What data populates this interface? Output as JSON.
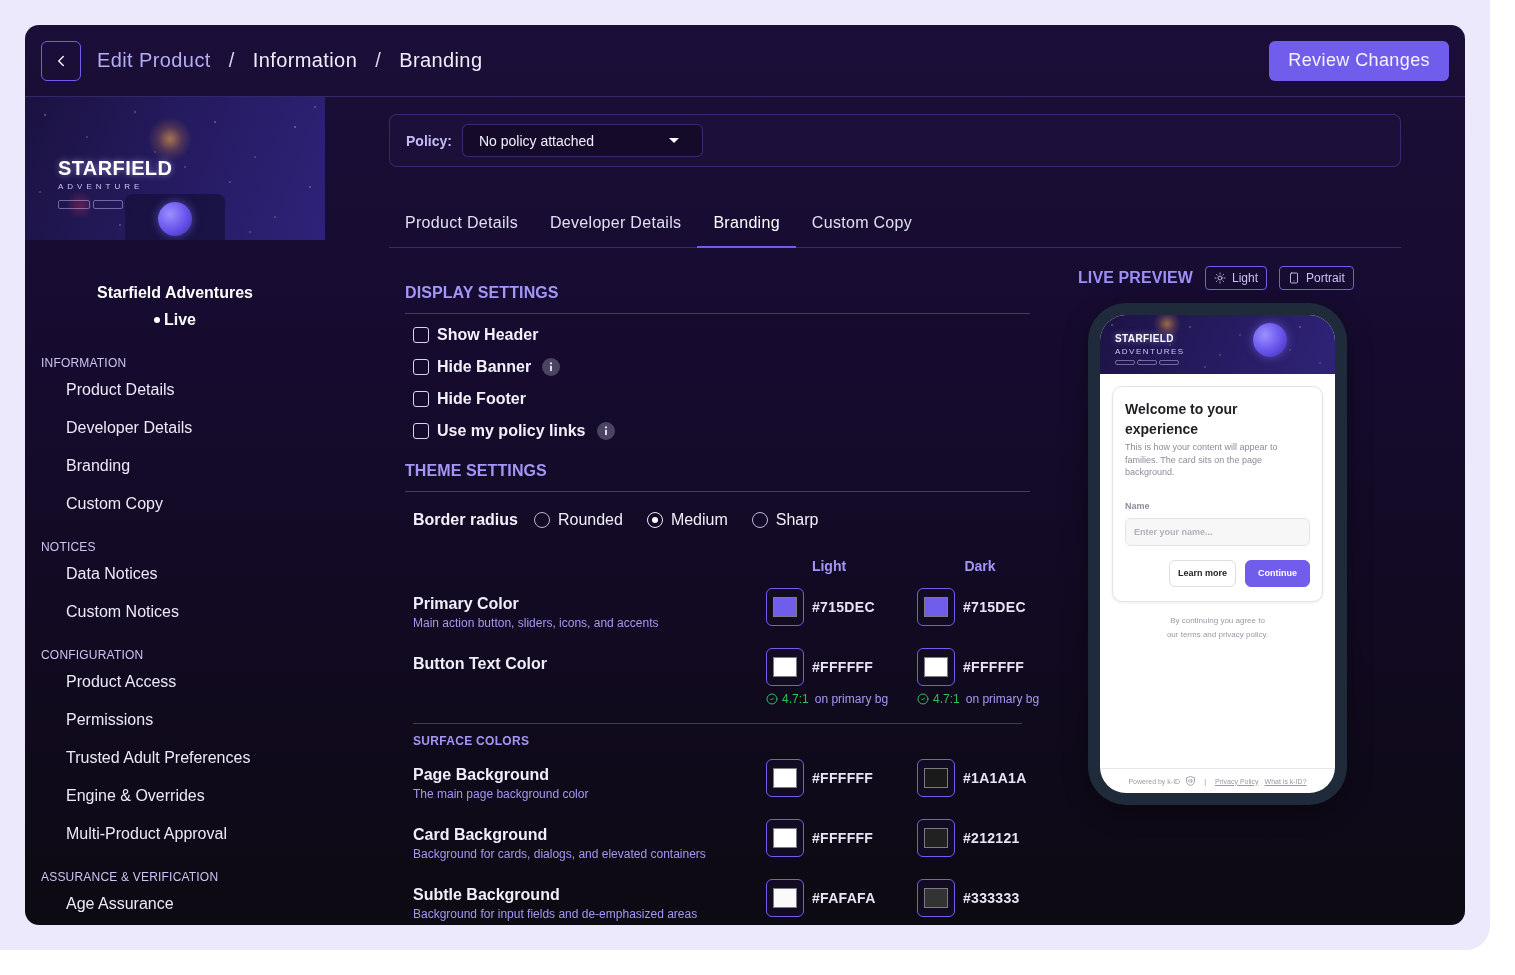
{
  "breadcrumb": [
    {
      "kind": "root",
      "label": "Edit Product"
    },
    {
      "kind": "separator",
      "label": "/"
    },
    {
      "kind": "page",
      "label": "Information"
    },
    {
      "kind": "separator",
      "label": "/"
    },
    {
      "kind": "page",
      "label": "Branding"
    }
  ],
  "header_action": {
    "label": "Review Changes"
  },
  "sidebar": {
    "banner": {
      "title": "STARFIELD",
      "subtitle": "ADVENTURE"
    },
    "product": {
      "name": "Starfield Adventures",
      "status": "Live"
    },
    "sections": [
      {
        "title": "INFORMATION",
        "items": [
          {
            "label": "Product Details",
            "selected": false
          },
          {
            "label": "Developer Details",
            "selected": false
          },
          {
            "label": "Branding",
            "selected": false
          },
          {
            "label": "Custom Copy",
            "selected": false
          }
        ]
      },
      {
        "title": "NOTICES",
        "items": [
          {
            "label": "Data Notices",
            "selected": false
          },
          {
            "label": "Custom Notices",
            "selected": false
          }
        ]
      },
      {
        "title": "CONFIGURATION",
        "items": [
          {
            "label": "Product Access",
            "selected": false
          },
          {
            "label": "Permissions",
            "selected": false
          },
          {
            "label": "Trusted Adult Preferences",
            "selected": false
          },
          {
            "label": "Engine & Overrides",
            "selected": false
          },
          {
            "label": "Multi-Product Approval",
            "selected": false
          }
        ]
      },
      {
        "title": "ASSURANCE & VERIFICATION",
        "items": [
          {
            "label": "Age Assurance",
            "selected": false
          }
        ]
      }
    ]
  },
  "policy": {
    "label": "Policy:",
    "value": "No policy attached"
  },
  "tabs": [
    {
      "label": "Product Details",
      "selected": false
    },
    {
      "label": "Developer Details",
      "selected": false
    },
    {
      "label": "Branding",
      "selected": true
    },
    {
      "label": "Custom Copy",
      "selected": false
    }
  ],
  "display_settings": {
    "title": "DISPLAY SETTINGS",
    "options": [
      {
        "label": "Show Header",
        "checked": false,
        "info": false
      },
      {
        "label": "Hide Banner",
        "checked": false,
        "info": true
      },
      {
        "label": "Hide Footer",
        "checked": false,
        "info": false
      },
      {
        "label": "Use my policy links",
        "checked": false,
        "info": true
      }
    ]
  },
  "theme_settings": {
    "title": "THEME SETTINGS",
    "border_radius": {
      "label": "Border radius",
      "options": [
        {
          "label": "Rounded",
          "selected": false
        },
        {
          "label": "Medium",
          "selected": true
        },
        {
          "label": "Sharp",
          "selected": false
        }
      ]
    },
    "columns": [
      "Light",
      "Dark"
    ],
    "colors": [
      {
        "name": "Primary Color",
        "description": "Main action button, sliders, icons, and accents",
        "light": {
          "value": "#715DEC",
          "color": "#715dec"
        },
        "dark": {
          "value": "#715DEC",
          "color": "#715dec"
        }
      },
      {
        "name": "Button Text Color",
        "light": {
          "value": "#FFFFFF",
          "color": "#ffffff",
          "contrast": {
            "ratio": "4.7:1",
            "note": "on primary bg",
            "passes": true
          }
        },
        "dark": {
          "value": "#FFFFFF",
          "color": "#ffffff",
          "contrast": {
            "ratio": "4.7:1",
            "note": "on primary bg",
            "passes": true
          }
        }
      }
    ],
    "surface_title": "SURFACE COLORS",
    "surface_colors": [
      {
        "name": "Page Background",
        "description": "The main page background color",
        "light": {
          "value": "#FFFFFF",
          "color": "#ffffff"
        },
        "dark": {
          "value": "#1A1A1A",
          "color": "#1a1a1a"
        }
      },
      {
        "name": "Card Background",
        "description": "Background for cards, dialogs, and elevated containers",
        "light": {
          "value": "#FFFFFF",
          "color": "#ffffff"
        },
        "dark": {
          "value": "#212121",
          "color": "#212121"
        }
      },
      {
        "name": "Subtle Background",
        "description": "Background for input fields and de-emphasized areas",
        "light": {
          "value": "#FAFAFA",
          "color": "#fafafa"
        },
        "dark": {
          "value": "#333333",
          "color": "#333333"
        }
      }
    ]
  },
  "preview": {
    "title": "LIVE PREVIEW",
    "mode_buttons": [
      {
        "kind": "theme",
        "label": "Light"
      },
      {
        "kind": "orientation",
        "label": "Portrait"
      }
    ],
    "screen": {
      "banner": {
        "title": "STARFIELD",
        "subtitle": "ADVENTURES"
      },
      "card": {
        "title": "Welcome to your experience",
        "body": "This is how your content will appear to families. The card sits on the page background.",
        "field": {
          "label": "Name",
          "placeholder": "Enter your name..."
        },
        "buttons": [
          {
            "kind": "secondary",
            "label": "Learn more"
          },
          {
            "kind": "primary",
            "label": "Continue"
          }
        ]
      },
      "terms": "By continuing you agree to our terms and privacy policy.",
      "footer": {
        "powered_by": "Powered by k-ID",
        "separator": "|",
        "links": [
          {
            "label": "Privacy Policy"
          },
          {
            "label": "What is k-ID?"
          }
        ]
      }
    }
  }
}
